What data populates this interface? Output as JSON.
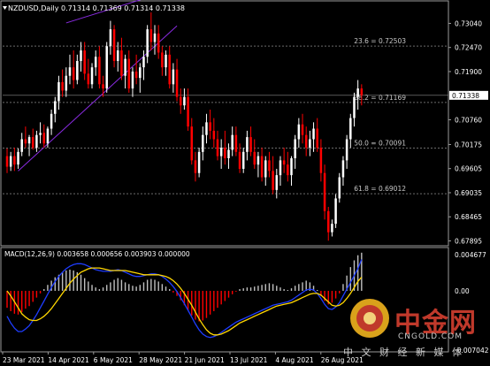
{
  "chart_data": [
    {
      "type": "candlestick",
      "symbol": "NZDUSD,Daily",
      "header_values": [
        "0.71314",
        "0.71369",
        "0.71314",
        "0.71338"
      ],
      "price_labels": [
        "0.73040",
        "0.72470",
        "0.71900",
        "0.71338",
        "0.70760",
        "0.70175",
        "0.69605",
        "0.69035",
        "0.68465",
        "0.67895"
      ],
      "last_price": 0.71338,
      "ylim": [
        0.6778,
        0.7353
      ],
      "fib_levels": [
        {
          "label": "23.6 = 0.72503",
          "value": 0.72503
        },
        {
          "label": "38.2 = 0.71169",
          "value": 0.71169
        },
        {
          "label": "50.0 = 0.70091",
          "value": 0.70091
        },
        {
          "label": "61.8 = 0.69012",
          "value": 0.69012
        }
      ],
      "x_labels": [
        "23 Mar 2021",
        "14 Apr 2021",
        "6 May 2021",
        "28 May 2021",
        "21 Jun 2021",
        "13 Jul 2021",
        "4 Aug 2021",
        "26 Aug 2021"
      ],
      "ohlc": [
        [
          0.699,
          0.7008,
          0.695,
          0.6965
        ],
        [
          0.6965,
          0.7,
          0.6955,
          0.699
        ],
        [
          0.699,
          0.701,
          0.6955,
          0.697
        ],
        [
          0.697,
          0.7008,
          0.696,
          0.7
        ],
        [
          0.7,
          0.7045,
          0.699,
          0.703
        ],
        [
          0.703,
          0.706,
          0.701,
          0.702
        ],
        [
          0.702,
          0.704,
          0.699,
          0.7035
        ],
        [
          0.7035,
          0.7055,
          0.7005,
          0.701
        ],
        [
          0.701,
          0.705,
          0.7,
          0.704
        ],
        [
          0.704,
          0.707,
          0.702,
          0.7045
        ],
        [
          0.7045,
          0.7065,
          0.701,
          0.702
        ],
        [
          0.702,
          0.706,
          0.701,
          0.7055
        ],
        [
          0.7055,
          0.71,
          0.704,
          0.709
        ],
        [
          0.709,
          0.713,
          0.707,
          0.712
        ],
        [
          0.712,
          0.718,
          0.71,
          0.7165
        ],
        [
          0.7165,
          0.7195,
          0.713,
          0.7145
        ],
        [
          0.7145,
          0.72,
          0.713,
          0.718
        ],
        [
          0.718,
          0.723,
          0.716,
          0.72
        ],
        [
          0.72,
          0.724,
          0.715,
          0.717
        ],
        [
          0.717,
          0.723,
          0.716,
          0.7215
        ],
        [
          0.7215,
          0.726,
          0.719,
          0.724
        ],
        [
          0.724,
          0.726,
          0.717,
          0.7185
        ],
        [
          0.7185,
          0.722,
          0.715,
          0.716
        ],
        [
          0.716,
          0.721,
          0.715,
          0.72
        ],
        [
          0.72,
          0.724,
          0.718,
          0.7225
        ],
        [
          0.7225,
          0.725,
          0.715,
          0.716
        ],
        [
          0.716,
          0.718,
          0.713,
          0.715
        ],
        [
          0.715,
          0.726,
          0.714,
          0.725
        ],
        [
          0.725,
          0.731,
          0.723,
          0.729
        ],
        [
          0.729,
          0.73,
          0.72,
          0.7215
        ],
        [
          0.7215,
          0.726,
          0.719,
          0.724
        ],
        [
          0.724,
          0.727,
          0.717,
          0.718
        ],
        [
          0.718,
          0.723,
          0.715,
          0.722
        ],
        [
          0.722,
          0.724,
          0.714,
          0.715
        ],
        [
          0.715,
          0.72,
          0.713,
          0.719
        ],
        [
          0.719,
          0.723,
          0.716,
          0.7175
        ],
        [
          0.7175,
          0.721,
          0.714,
          0.72
        ],
        [
          0.72,
          0.724,
          0.717,
          0.7225
        ],
        [
          0.7225,
          0.73,
          0.721,
          0.729
        ],
        [
          0.729,
          0.733,
          0.724,
          0.726
        ],
        [
          0.726,
          0.73,
          0.723,
          0.728
        ],
        [
          0.728,
          0.73,
          0.722,
          0.7235
        ],
        [
          0.7235,
          0.725,
          0.718,
          0.72
        ],
        [
          0.72,
          0.724,
          0.718,
          0.723
        ],
        [
          0.723,
          0.725,
          0.715,
          0.716
        ],
        [
          0.716,
          0.721,
          0.714,
          0.7195
        ],
        [
          0.7195,
          0.722,
          0.712,
          0.713
        ],
        [
          0.713,
          0.715,
          0.709,
          0.711
        ],
        [
          0.711,
          0.715,
          0.71,
          0.713
        ],
        [
          0.713,
          0.715,
          0.705,
          0.706
        ],
        [
          0.706,
          0.708,
          0.697,
          0.698
        ],
        [
          0.698,
          0.7,
          0.693,
          0.695
        ],
        [
          0.695,
          0.701,
          0.694,
          0.7
        ],
        [
          0.7,
          0.706,
          0.698,
          0.704
        ],
        [
          0.704,
          0.709,
          0.702,
          0.707
        ],
        [
          0.707,
          0.71,
          0.703,
          0.705
        ],
        [
          0.705,
          0.708,
          0.701,
          0.703
        ],
        [
          0.703,
          0.705,
          0.698,
          0.699
        ],
        [
          0.699,
          0.703,
          0.696,
          0.701
        ],
        [
          0.701,
          0.705,
          0.697,
          0.6985
        ],
        [
          0.6985,
          0.702,
          0.696,
          0.7005
        ],
        [
          0.7005,
          0.706,
          0.699,
          0.704
        ],
        [
          0.704,
          0.706,
          0.699,
          0.7
        ],
        [
          0.7,
          0.702,
          0.695,
          0.696
        ],
        [
          0.696,
          0.701,
          0.695,
          0.7
        ],
        [
          0.7,
          0.705,
          0.698,
          0.7035
        ],
        [
          0.7035,
          0.706,
          0.699,
          0.7
        ],
        [
          0.7,
          0.703,
          0.696,
          0.697
        ],
        [
          0.697,
          0.7,
          0.694,
          0.699
        ],
        [
          0.699,
          0.701,
          0.693,
          0.694
        ],
        [
          0.694,
          0.699,
          0.692,
          0.698
        ],
        [
          0.698,
          0.7,
          0.694,
          0.6955
        ],
        [
          0.6955,
          0.699,
          0.69,
          0.691
        ],
        [
          0.691,
          0.696,
          0.689,
          0.6945
        ],
        [
          0.6945,
          0.699,
          0.692,
          0.698
        ],
        [
          0.698,
          0.701,
          0.695,
          0.697
        ],
        [
          0.697,
          0.7,
          0.693,
          0.6945
        ],
        [
          0.6945,
          0.699,
          0.692,
          0.6985
        ],
        [
          0.6985,
          0.704,
          0.696,
          0.703
        ],
        [
          0.703,
          0.708,
          0.701,
          0.7065
        ],
        [
          0.7065,
          0.709,
          0.702,
          0.704
        ],
        [
          0.704,
          0.706,
          0.699,
          0.701
        ],
        [
          0.701,
          0.705,
          0.699,
          0.703
        ],
        [
          0.703,
          0.707,
          0.7,
          0.7055
        ],
        [
          0.7055,
          0.708,
          0.7,
          0.701
        ],
        [
          0.701,
          0.703,
          0.693,
          0.695
        ],
        [
          0.695,
          0.697,
          0.684,
          0.686
        ],
        [
          0.686,
          0.687,
          0.679,
          0.681
        ],
        [
          0.681,
          0.684,
          0.68,
          0.683
        ],
        [
          0.683,
          0.69,
          0.682,
          0.689
        ],
        [
          0.689,
          0.695,
          0.688,
          0.694
        ],
        [
          0.694,
          0.699,
          0.692,
          0.698
        ],
        [
          0.698,
          0.704,
          0.696,
          0.703
        ],
        [
          0.703,
          0.709,
          0.701,
          0.708
        ],
        [
          0.708,
          0.714,
          0.706,
          0.713
        ],
        [
          0.713,
          0.717,
          0.71,
          0.715
        ],
        [
          0.715,
          0.716,
          0.711,
          0.7134
        ]
      ]
    },
    {
      "type": "macd",
      "title": "MACD(12,26,9) 0.003658 0.000656 0.003903 0.000000",
      "y_labels": [
        "0.004677",
        "0.00",
        "-0.007042"
      ],
      "ylim": [
        -0.0072,
        0.0049
      ],
      "histogram": [
        -0.002,
        -0.0024,
        -0.0027,
        -0.0028,
        -0.0025,
        -0.0021,
        -0.0018,
        -0.0013,
        -0.0008,
        -0.0003,
        0.0002,
        0.0007,
        0.0012,
        0.0016,
        0.0019,
        0.0022,
        0.0024,
        0.0025,
        0.0024,
        0.0022,
        0.0019,
        0.0015,
        0.0011,
        0.0007,
        0.0004,
        0.0002,
        0.0004,
        0.0007,
        0.001,
        0.0013,
        0.0015,
        0.0013,
        0.001,
        0.0008,
        0.0006,
        0.0005,
        0.0007,
        0.001,
        0.0013,
        0.0014,
        0.0013,
        0.0011,
        0.0008,
        0.0005,
        0.0002,
        -0.0002,
        -0.0006,
        -0.0011,
        -0.0017,
        -0.0023,
        -0.0029,
        -0.0034,
        -0.0036,
        -0.0035,
        -0.0032,
        -0.0028,
        -0.0024,
        -0.002,
        -0.0016,
        -0.0012,
        -0.0008,
        -0.0004,
        -0.0001,
        0.0002,
        0.0003,
        0.0004,
        0.0004,
        0.0005,
        0.0006,
        0.0007,
        0.0008,
        0.0009,
        0.0008,
        0.0006,
        0.0004,
        0.0002,
        0.0001,
        0.0003,
        0.0006,
        0.0008,
        0.001,
        0.0012,
        0.001,
        0.0006,
        0.0001,
        -0.0006,
        -0.0012,
        -0.0016,
        -0.0014,
        -0.0009,
        -0.0003,
        0.0008,
        0.0018,
        0.0028,
        0.0036,
        0.0042,
        0.0045
      ],
      "macd": [
        -0.003,
        -0.0038,
        -0.0044,
        -0.0048,
        -0.0048,
        -0.0045,
        -0.0041,
        -0.0035,
        -0.0028,
        -0.002,
        -0.0012,
        -0.0004,
        0.0004,
        0.0011,
        0.0017,
        0.0022,
        0.0026,
        0.0029,
        0.0031,
        0.0032,
        0.0032,
        0.0031,
        0.0029,
        0.0027,
        0.0025,
        0.0024,
        0.0023,
        0.0023,
        0.0023,
        0.0024,
        0.0025,
        0.0024,
        0.0022,
        0.002,
        0.0018,
        0.0017,
        0.0017,
        0.0018,
        0.0019,
        0.002,
        0.002,
        0.0019,
        0.0017,
        0.0014,
        0.001,
        0.0005,
        -0.0001,
        -0.0008,
        -0.0015,
        -0.0023,
        -0.0031,
        -0.0039,
        -0.0046,
        -0.0051,
        -0.0054,
        -0.0055,
        -0.0054,
        -0.0052,
        -0.0049,
        -0.0046,
        -0.0043,
        -0.004,
        -0.0037,
        -0.0035,
        -0.0033,
        -0.0031,
        -0.0029,
        -0.0027,
        -0.0025,
        -0.0023,
        -0.0021,
        -0.0019,
        -0.0017,
        -0.0016,
        -0.0015,
        -0.0014,
        -0.0013,
        -0.0011,
        -0.0008,
        -0.0005,
        -0.0002,
        0.0001,
        0.0002,
        0.0001,
        -0.0003,
        -0.0009,
        -0.0016,
        -0.0021,
        -0.0022,
        -0.0019,
        -0.0014,
        -0.0006,
        0.0002,
        0.001,
        0.0018,
        0.0026,
        0.0037
      ],
      "signal": [
        0.0,
        -0.0006,
        -0.0013,
        -0.002,
        -0.0027,
        -0.0031,
        -0.0034,
        -0.0035,
        -0.0035,
        -0.0033,
        -0.003,
        -0.0026,
        -0.0021,
        -0.0015,
        -0.0009,
        -0.0003,
        0.0003,
        0.0009,
        0.0014,
        0.0018,
        0.0022,
        0.0024,
        0.0026,
        0.0027,
        0.0027,
        0.0027,
        0.0026,
        0.0025,
        0.0024,
        0.0024,
        0.0024,
        0.0024,
        0.0024,
        0.0023,
        0.0022,
        0.0021,
        0.002,
        0.0019,
        0.0019,
        0.0019,
        0.0019,
        0.0019,
        0.0018,
        0.0017,
        0.0015,
        0.0012,
        0.0008,
        0.0003,
        -0.0003,
        -0.001,
        -0.0017,
        -0.0025,
        -0.0033,
        -0.004,
        -0.0046,
        -0.005,
        -0.0052,
        -0.0052,
        -0.0051,
        -0.0049,
        -0.0047,
        -0.0044,
        -0.0041,
        -0.0038,
        -0.0036,
        -0.0034,
        -0.0032,
        -0.003,
        -0.0028,
        -0.0026,
        -0.0024,
        -0.0022,
        -0.002,
        -0.0018,
        -0.0017,
        -0.0016,
        -0.0015,
        -0.0014,
        -0.0012,
        -0.001,
        -0.0008,
        -0.0006,
        -0.0004,
        -0.0003,
        -0.0003,
        -0.0005,
        -0.0009,
        -0.0013,
        -0.0017,
        -0.0018,
        -0.0017,
        -0.0014,
        -0.0009,
        -0.0003,
        0.0004,
        0.0011,
        0.0016
      ]
    }
  ],
  "colors": {
    "background": "#000000",
    "bull": "#ffffff",
    "bear": "#ff0000",
    "grid": "#6b6b6b",
    "trendline": "#8a2be2",
    "macd_histogram": "#c0c0c0",
    "macd_line": "#1e3cff",
    "signal_line": "#ffd700",
    "text": "#ffffff"
  },
  "watermark": {
    "title": "中金网",
    "sub": "CNGOLD.COM",
    "cn": "中 文 财 经 新 媒 体"
  }
}
